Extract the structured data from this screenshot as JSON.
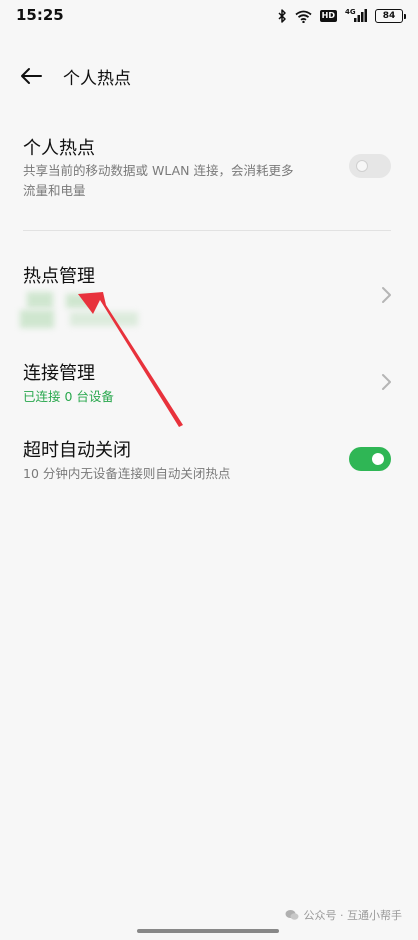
{
  "status_bar": {
    "time": "15:25",
    "network": "4G",
    "hd_label": "HD",
    "battery_level": "84",
    "icons": [
      "bluetooth-icon",
      "wifi-icon",
      "hd-icon",
      "signal-icon",
      "battery-icon"
    ]
  },
  "header": {
    "title": "个人热点",
    "back_icon": "back-arrow-icon"
  },
  "hotspot": {
    "title": "个人热点",
    "description_line1": "共享当前的移动数据或 WLAN 连接，会消耗更多",
    "description_line2": "流量和电量",
    "enabled": false
  },
  "hotspot_management": {
    "title": "热点管理",
    "subtitle_obscured": true
  },
  "connection_management": {
    "title": "连接管理",
    "status": "已连接 0 台设备"
  },
  "auto_off": {
    "title": "超时自动关闭",
    "description": "10 分钟内无设备连接则自动关闭热点",
    "enabled": true
  },
  "watermark": {
    "text": "公众号 · 互通小帮手"
  },
  "colors": {
    "background": "#f7f7f7",
    "accent_green": "#2fb655",
    "status_green": "#2aa84e",
    "annotation_red": "#e8323c"
  }
}
